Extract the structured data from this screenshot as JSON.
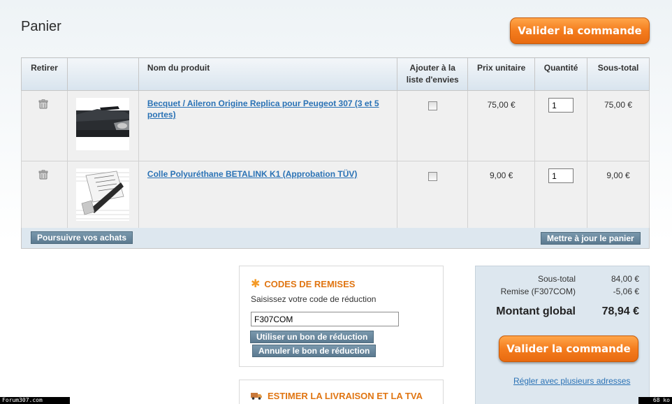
{
  "page": {
    "title": "Panier",
    "checkout_label": "Valider la commande"
  },
  "table": {
    "headers": {
      "remove": "Retirer",
      "image": "",
      "name": "Nom du produit",
      "wishlist": "Ajouter à la liste d'envies",
      "unit_price": "Prix unitaire",
      "quantity": "Quantité",
      "subtotal": "Sous-total"
    },
    "rows": [
      {
        "name": "Becquet / Aileron Origine Replica pour Peugeot 307 (3 et 5 portes)",
        "wishlist_checked": false,
        "unit_price": "75,00 €",
        "quantity": "1",
        "subtotal": "75,00 €",
        "image_icon": "car-spoiler-photo"
      },
      {
        "name": "Colle Polyuréthane BETALINK K1 (Approbation TÜV)",
        "wishlist_checked": false,
        "unit_price": "9,00 €",
        "quantity": "1",
        "subtotal": "9,00 €",
        "image_icon": "glue-product-photo"
      }
    ],
    "continue_label": "Poursuivre vos achats",
    "update_label": "Mettre à jour le panier"
  },
  "coupon": {
    "heading": "CODES DE REMISES",
    "prompt": "Saisissez votre code de réduction",
    "code_value": "F307COM",
    "apply_label": "Utiliser un bon de réduction",
    "cancel_label": "Annuler le bon de réduction"
  },
  "shipping": {
    "heading": "ESTIMER LA LIVRAISON ET LA TVA"
  },
  "totals": {
    "subtotal_label": "Sous-total",
    "subtotal_value": "84,00 €",
    "discount_label": "Remise (F307COM)",
    "discount_value": "-5,06 €",
    "grand_label": "Montant global",
    "grand_value": "78,94 €",
    "multi_address_link": "Régler avec plusieurs adresses"
  },
  "watermark": {
    "left": "Forum307.com",
    "right": "68 ko"
  },
  "colors": {
    "accent_orange": "#f47d1e",
    "link_blue": "#2a72b5",
    "grey_button": "#5b7a90",
    "panel_blue": "#dde7ef"
  }
}
